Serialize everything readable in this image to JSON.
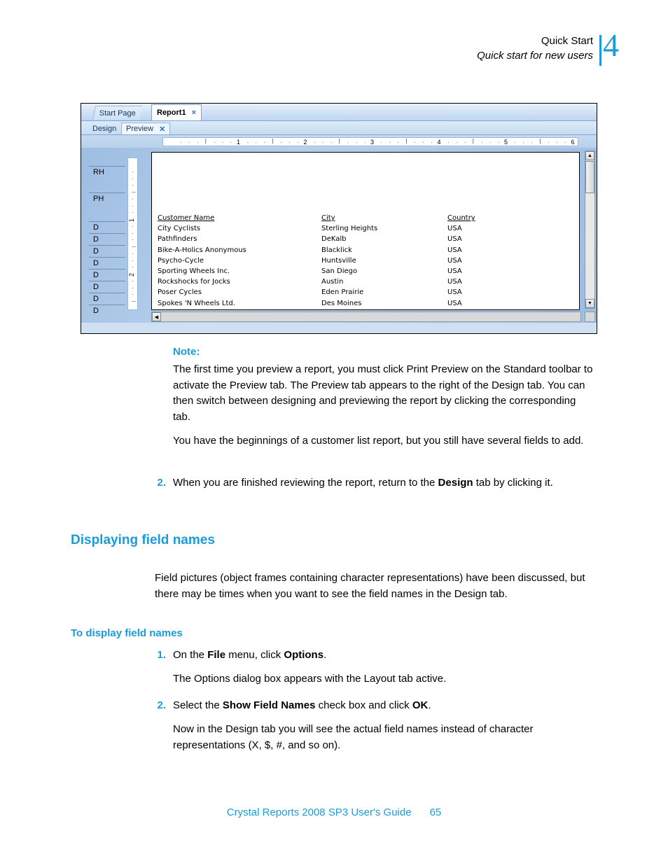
{
  "header": {
    "line1": "Quick Start",
    "line2": "Quick start for new users",
    "chapter": "4"
  },
  "screenshot": {
    "doc_tabs": [
      {
        "label": "Start Page",
        "active": false,
        "closable": false
      },
      {
        "label": "Report1",
        "active": true,
        "closable": true,
        "close": "×"
      }
    ],
    "view_tabs": [
      {
        "label": "Design",
        "active": false,
        "closable": false
      },
      {
        "label": "Preview",
        "active": true,
        "closable": true,
        "close": "✕"
      }
    ],
    "h_ruler_numbers": [
      "1",
      "2",
      "3",
      "4",
      "5",
      "6"
    ],
    "v_ruler_numbers": [
      "1",
      "2"
    ],
    "sections": [
      "RH",
      "PH",
      "D",
      "D",
      "D",
      "D",
      "D",
      "D",
      "D",
      "D"
    ],
    "report": {
      "columns": [
        "Customer Name",
        "City",
        "Country"
      ],
      "rows": [
        [
          "City Cyclists",
          "Sterling Heights",
          "USA"
        ],
        [
          "Pathfinders",
          "DeKalb",
          "USA"
        ],
        [
          "Bike-A-Holics Anonymous",
          "Blacklick",
          "USA"
        ],
        [
          "Psycho-Cycle",
          "Huntsville",
          "USA"
        ],
        [
          "Sporting Wheels Inc.",
          "San Diego",
          "USA"
        ],
        [
          "Rockshocks for Jocks",
          "Austin",
          "USA"
        ],
        [
          "Poser Cycles",
          "Eden Prairie",
          "USA"
        ],
        [
          "Spokes 'N Wheels Ltd.",
          "Des Moines",
          "USA"
        ]
      ]
    },
    "scroll": {
      "up_arrow": "▲",
      "down_arrow": "▼",
      "left_arrow": "◀",
      "right_arrow": "▶"
    }
  },
  "note": {
    "label": "Note:",
    "paragraph1": "The first time you preview a report, you must click Print Preview on the Standard toolbar to activate the Preview tab. The Preview tab appears to the right of the Design tab. You can then switch between designing and previewing the report by clicking the corresponding tab.",
    "paragraph2": "You have the beginnings of a customer list report, but you still have several fields to add."
  },
  "step_two": {
    "number": "2.",
    "text_before": "When you are finished reviewing the report, return to the ",
    "bold": "Design",
    "text_after": " tab by clicking it."
  },
  "section_displaying": {
    "heading": "Displaying field names",
    "paragraph": "Field pictures (object frames containing character representations) have been discussed, but there may be times when you want to see the field names in the Design tab."
  },
  "section_to_display": {
    "heading": "To display field names",
    "step1": {
      "number": "1.",
      "before": "On the ",
      "bold1": "File",
      "middle": " menu, click ",
      "bold2": "Options",
      "after": "."
    },
    "step1_result": "The Options dialog box appears with the Layout tab active.",
    "step2": {
      "number": "2.",
      "before": "Select the ",
      "bold1": "Show Field Names",
      "middle": " check box and click ",
      "bold2": "OK",
      "after": "."
    },
    "step2_result": "Now in the Design tab you will see the actual field names instead of character representations (X, $, #, and so on)."
  },
  "footer": {
    "title": "Crystal Reports 2008 SP3 User's Guide",
    "page": "65"
  },
  "colors": {
    "accent": "#1a9cd8",
    "text": "#000000"
  }
}
